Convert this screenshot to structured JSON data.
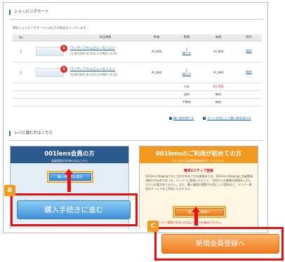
{
  "cart": {
    "title": "ショッピングカート",
    "note": "現在ショッピングカートには以下の商品が入っています。",
    "columns": [
      "No",
      "",
      "商品情報",
      "単価",
      "数量",
      "価格",
      "削除"
    ],
    "items": [
      {
        "no": "1",
        "name": "ワンデーアキュビューモイスト",
        "spec": "[左]BC/DIA (8.5/14.2) PWR:(-4.25)",
        "badge": "1",
        "price": "¥1,880",
        "qty": "1",
        "qty_link": "減らす",
        "total": "¥1,880",
        "delete": "削除"
      },
      {
        "no": "2",
        "name": "ワンデーアキュビューモイスト",
        "spec": "[右]BC/DIA (8.5/14.2) PWR:(-4.25)",
        "badge": "1",
        "price": "¥1,880",
        "qty": "1",
        "qty_link": "減らす",
        "total": "¥1,880",
        "delete": "削除"
      }
    ],
    "subtotal_label": "小計",
    "subtotal_value": "¥3,760",
    "shipping_label": "送料",
    "shipping_value": "無料",
    "fee_label": "手数料",
    "fee_value": "無料",
    "continue_link": "買い物を続ける",
    "empty_link": "カートを空にして買い物を続ける"
  },
  "register": {
    "title": "レジに進む方はこちら",
    "member": {
      "heading": "001lens会員の方",
      "subheading": "会員登録がお済の方はこちら",
      "button": "購入手続きに進む",
      "yahoo_note": "【Yahoo!またはHotmail利用の新規会員様へ】"
    },
    "guest": {
      "heading": "001lensのご利用が初めての方",
      "subheading": "こちらから会員登録(無料)をしてください。",
      "steps_title": "簡単2ステップ登録",
      "description": "001lens-Stagingでのご注文が初めてのお客様または、001lens-Stagingに会員登録(無料)がお済でない方。メンバーに登録いただくと、次回からお客様の情報を入力いただく必要がありません。また、購入履歴の閲覧やお気に入り登録など、メンバー専用のサービスをご利用いただけます。",
      "button": "新規会員登録へ",
      "caution": "※メンバー登録されない方はこちらでお進みください。"
    }
  },
  "callouts": {
    "b_label": "B",
    "b_button": "購入手続きに進む",
    "c_label": "C",
    "c_button": "新規会員登録へ"
  },
  "colors": {
    "accent_blue": "#2a5a8e",
    "accent_orange": "#f39a1e",
    "highlight_red": "#e51010",
    "price_red": "#d0121b"
  }
}
